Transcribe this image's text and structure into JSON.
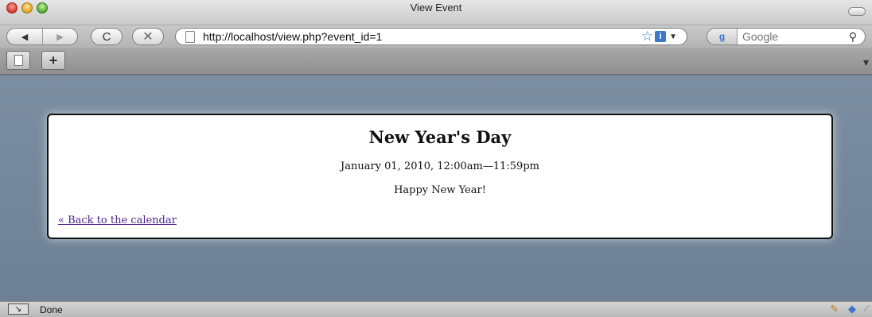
{
  "window": {
    "title": "View Event"
  },
  "toolbar": {
    "back_icon": "◀",
    "forward_icon": "▶",
    "reload_icon": "C",
    "stop_icon": "✕",
    "url": "http://localhost/view.php?event_id=1",
    "star_icon": "☆",
    "info_icon": "i",
    "dropdown_icon": "▼",
    "search_engine_icon": "g",
    "search_placeholder": "Google",
    "search_icon": "⚲"
  },
  "tabbar": {
    "add_tab_label": "+",
    "tab_menu_icon": "▾"
  },
  "event": {
    "title": "New Year's Day",
    "datetime": "January 01, 2010, 12:00am—11:59pm",
    "description": "Happy New Year!",
    "back_link": "« Back to the calendar"
  },
  "statusbar": {
    "status_text": "Done",
    "status_icon": "↘"
  },
  "colors": {
    "page_background": "#6f8296",
    "card_background": "#ffffff",
    "link_color": "#4b1f8f"
  }
}
